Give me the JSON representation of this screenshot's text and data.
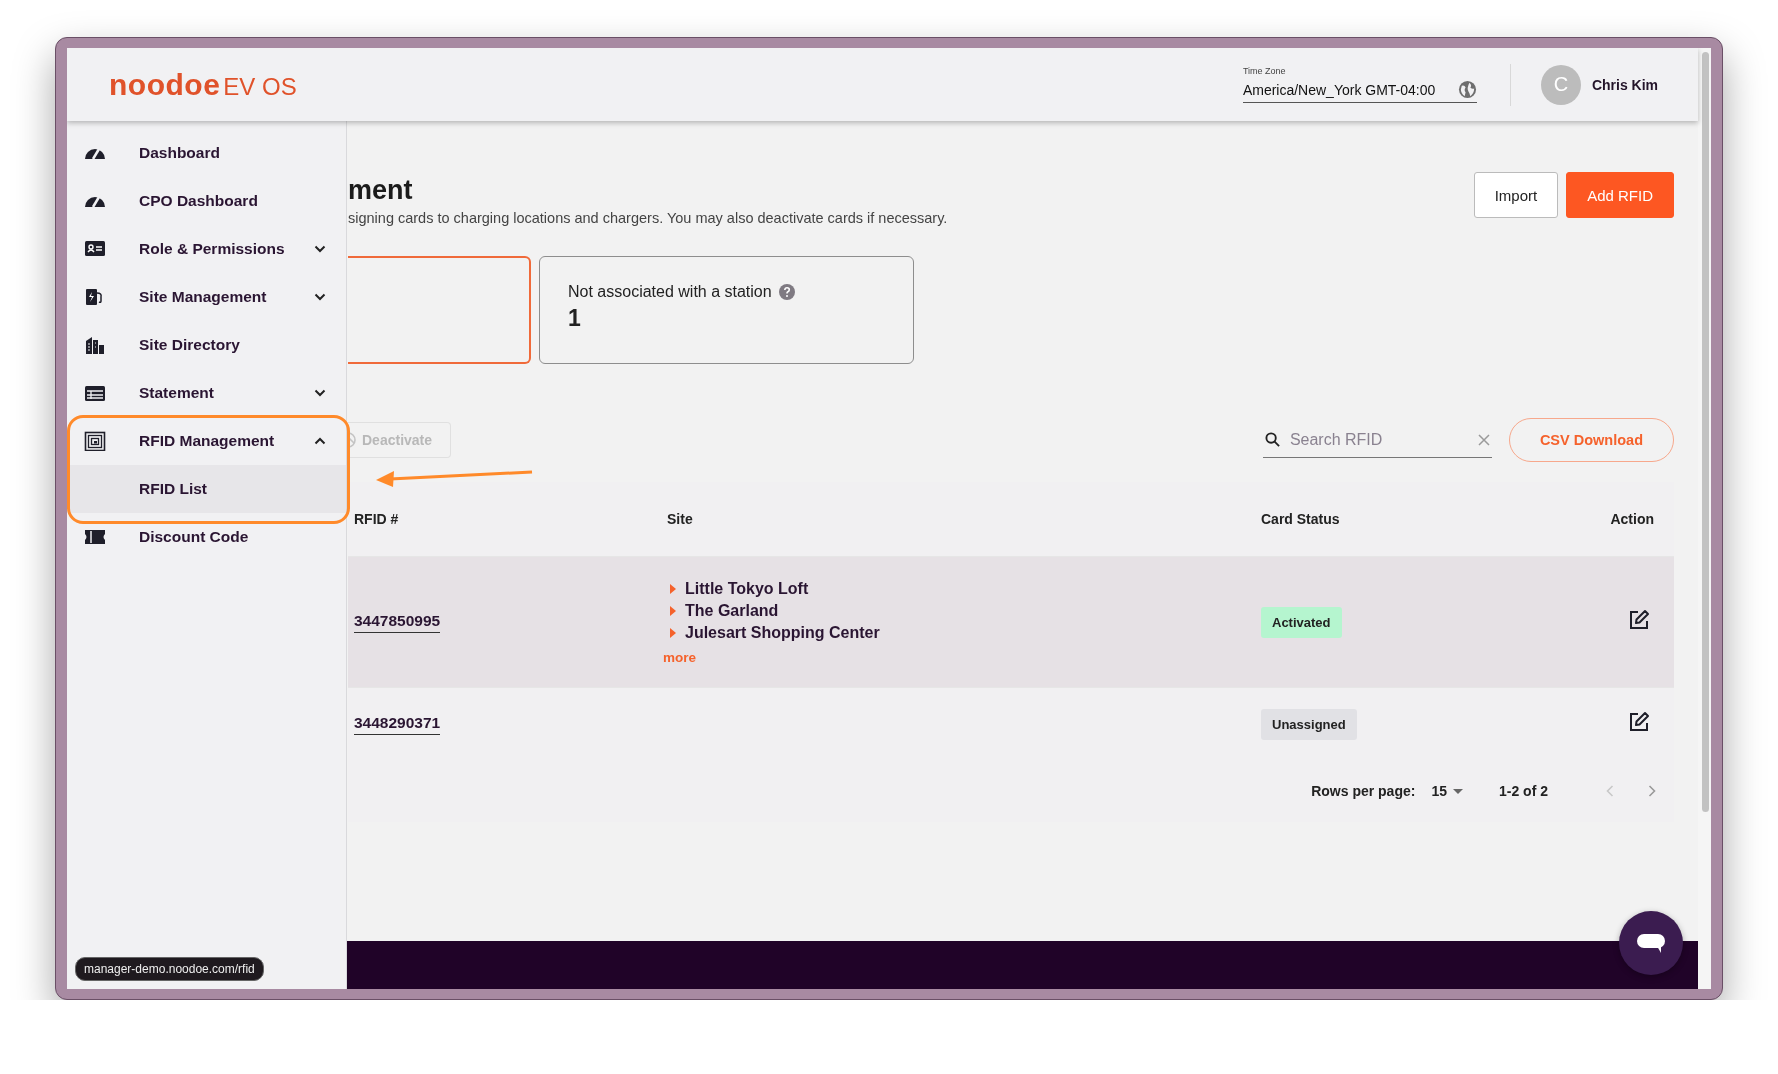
{
  "header": {
    "logo": {
      "brand": "noodoe",
      "product": "EV OS"
    },
    "time_zone": {
      "label": "Time Zone",
      "value": "America/New_York GMT-04:00"
    },
    "user": {
      "initial": "C",
      "name": "Chris Kim"
    }
  },
  "sidebar": {
    "items": [
      {
        "label": "Dashboard"
      },
      {
        "label": "CPO Dashboard"
      },
      {
        "label": "Role & Permissions",
        "expanded": false
      },
      {
        "label": "Site Management",
        "expanded": false
      },
      {
        "label": "Site Directory"
      },
      {
        "label": "Statement",
        "expanded": false
      },
      {
        "label": "RFID Management",
        "expanded": true,
        "children": [
          {
            "label": "RFID List",
            "selected": true
          }
        ]
      },
      {
        "label": "Discount Code"
      }
    ]
  },
  "page": {
    "title": "ment",
    "description": "signing cards to charging locations and chargers. You may also deactivate cards if necessary.",
    "buttons": [
      {
        "label": "Import",
        "kind": "secondary"
      },
      {
        "label": "Add RFID",
        "kind": "primary"
      }
    ]
  },
  "summary_cards": [
    {
      "selected": true
    },
    {
      "label": "Not associated with a station",
      "value": "1",
      "selected": false
    }
  ],
  "toolbar": {
    "deactivate": {
      "label": "Deactivate",
      "disabled": true
    },
    "search": {
      "placeholder": "Search RFID"
    },
    "csv_button": "CSV Download"
  },
  "table": {
    "columns": [
      "RFID #",
      "Site",
      "Card Status",
      "Action"
    ],
    "rows": [
      {
        "rfid": "3447850995",
        "sites": [
          "Little Tokyo Loft",
          "The Garland",
          "Julesart Shopping Center"
        ],
        "more": "more",
        "status": {
          "label": "Activated",
          "kind": "activated"
        },
        "highlighted": true
      },
      {
        "rfid": "3448290371",
        "status": {
          "label": "Unassigned",
          "kind": "unassigned"
        },
        "highlighted": false
      }
    ]
  },
  "pagination": {
    "rows_per_page_label": "Rows per page:",
    "rows_per_page": "15",
    "range": "1-2 of 2",
    "previous_disabled": true
  },
  "status_bar": {
    "url": "manager-demo.noodoe.com/rfid"
  }
}
